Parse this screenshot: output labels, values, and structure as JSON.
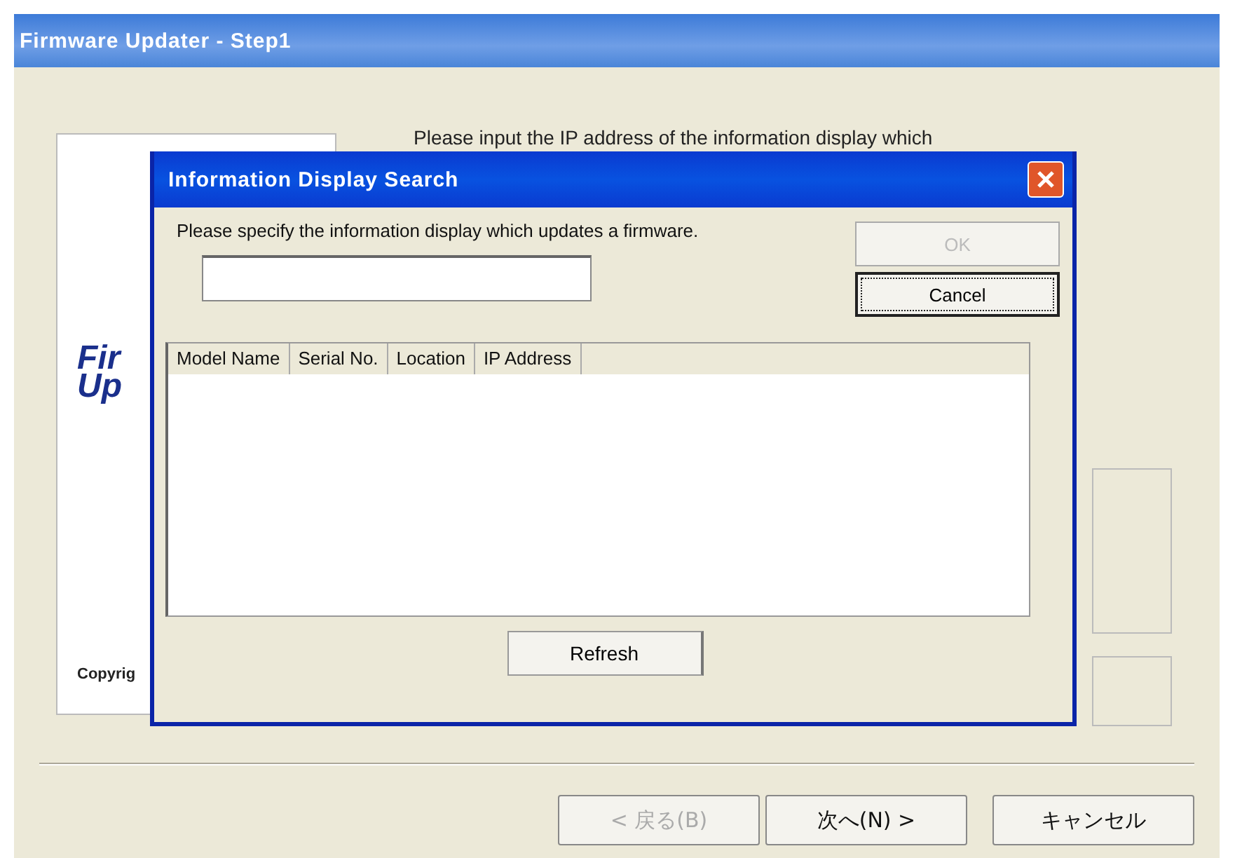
{
  "window": {
    "title": "Firmware Updater - Step1"
  },
  "instruction": "Please input the IP address of the information display which",
  "logo": [
    "Fir",
    "Up"
  ],
  "copyright": "Copyrig",
  "wizard_buttons": [
    {
      "label": "< 戻る(B)",
      "disabled": true
    },
    {
      "label": "次へ(N) >",
      "disabled": false
    },
    {
      "label": "キャンセル",
      "disabled": false
    }
  ],
  "dialog": {
    "title": "Information Display Search",
    "prompt": "Please specify the information display which updates a firmware.",
    "buttons": [
      {
        "label": "OK",
        "disabled": true,
        "focused": false
      },
      {
        "label": "Cancel",
        "disabled": false,
        "focused": true
      }
    ],
    "table": {
      "columns": [
        "Model Name",
        "Serial No.",
        "Location",
        "IP Address"
      ]
    },
    "refresh": "Refresh"
  }
}
